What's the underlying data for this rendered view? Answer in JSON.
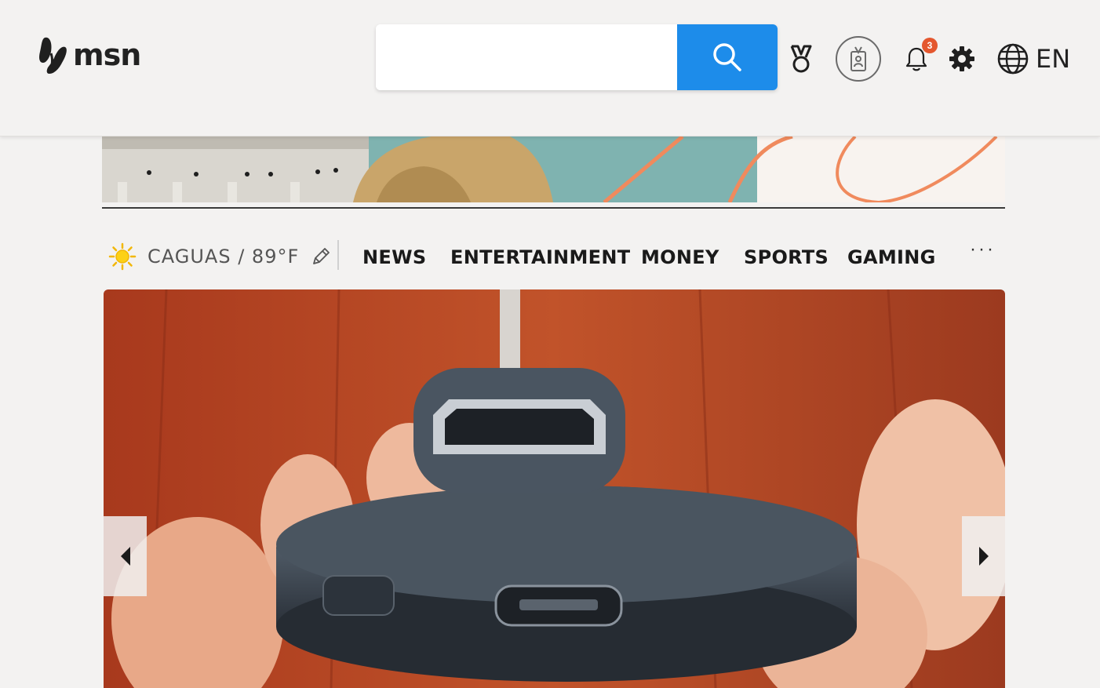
{
  "header": {
    "logo_text": "msn",
    "search": {
      "value": "",
      "placeholder": ""
    },
    "notifications_count": "3",
    "language": "EN",
    "icons": [
      "msn-butterfly-icon",
      "search-icon",
      "rewards-icon",
      "badge-icon",
      "bell-icon",
      "gear-icon",
      "globe-icon"
    ],
    "search_button_color": "#1d8cea"
  },
  "nav": {
    "weather": {
      "location": "CAGUAS",
      "separator": " / ",
      "temperature": "89°F",
      "icon": "sun-icon"
    },
    "items": [
      "NEWS",
      "ENTERTAINMENT",
      "MONEY",
      "SPORTS",
      "GAMING"
    ],
    "more": "···"
  },
  "carousel": {
    "image": "photo of hand holding a Chromecast device with HDMI connector on wooden background",
    "prev_icon": "chevron-left-icon",
    "next_icon": "chevron-right-icon"
  }
}
